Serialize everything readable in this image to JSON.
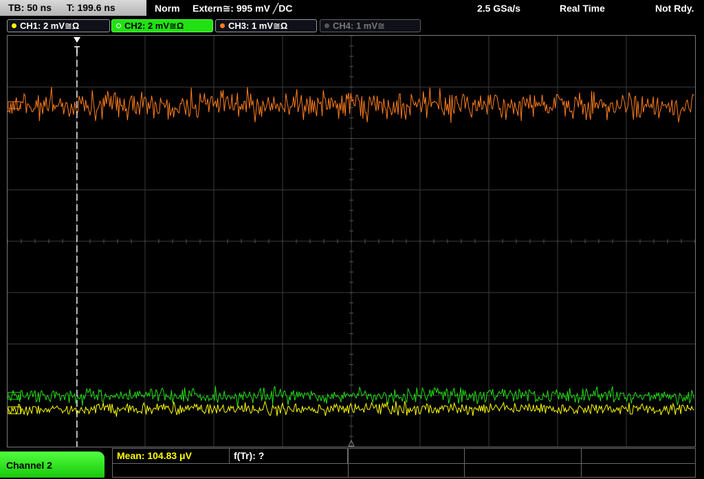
{
  "status": {
    "timebase": "TB: 50 ns",
    "trigger_time": "T: 199.6 ns",
    "mode": "Norm",
    "trigger": "Extern≅: 995 mV ╱DC",
    "sample_rate": "2.5 GSa/s",
    "acq_mode": "Real Time",
    "state": "Not Rdy."
  },
  "channels": [
    {
      "label": "CH1: 2 mV≅Ω",
      "color": "#ffff00",
      "active": false
    },
    {
      "label": "CH2: 2 mV≅Ω",
      "color": "#22e014",
      "active": true
    },
    {
      "label": "CH3: 1 mV≅Ω",
      "color": "#ff7f1e",
      "active": false
    },
    {
      "label": "CH4: 1 mV≅",
      "color": "#777777",
      "active": false
    }
  ],
  "colors": {
    "ch1": "#ffff00",
    "ch2": "#22e014",
    "ch3": "#ff7f1e",
    "grid": "#3c3c3c",
    "trigger_marker": "#ffffff"
  },
  "measurements": {
    "mean": "Mean: 104.83 μV",
    "freq": "f(Tr): ?"
  },
  "selected_channel": "Channel 2"
}
